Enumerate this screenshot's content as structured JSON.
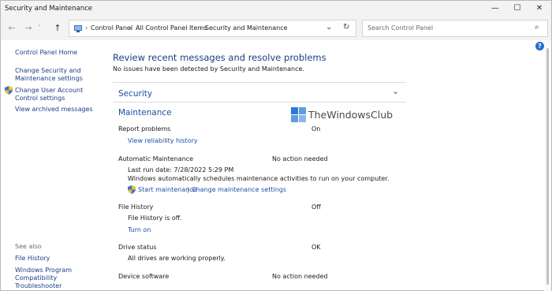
{
  "window": {
    "title": "Security and Maintenance",
    "minimize_glyph": "—",
    "maximize_glyph": "☐",
    "close_glyph": "✕"
  },
  "nav": {
    "back_glyph": "←",
    "forward_glyph": "→",
    "dropdown_glyph": "˅",
    "up_glyph": "↑",
    "breadcrumb": [
      "Control Panel",
      "All Control Panel Items",
      "Security and Maintenance"
    ],
    "separator": "›",
    "address_dropdown_glyph": "⌄",
    "refresh_glyph": "↻",
    "search_placeholder": "Search Control Panel",
    "search_glyph": "⌕"
  },
  "help_glyph": "?",
  "sidebar": {
    "home": "Control Panel Home",
    "links": [
      "Change Security and Maintenance settings",
      "Change User Account Control settings",
      "View archived messages"
    ],
    "see_also_label": "See also",
    "see_also": [
      "File History",
      "Windows Program Compatibility Troubleshooter"
    ]
  },
  "main": {
    "heading": "Review recent messages and resolve problems",
    "subheading": "No issues have been detected by Security and Maintenance.",
    "security_title": "Security",
    "maintenance_title": "Maintenance",
    "chevron_glyph": "⌄",
    "report_problems": {
      "label": "Report problems",
      "status": "On",
      "link": "View reliability history"
    },
    "automatic_maintenance": {
      "label": "Automatic Maintenance",
      "status": "No action needed",
      "last_run": "Last run date: 7/28/2022 5:29 PM",
      "description": "Windows automatically schedules maintenance activities to run on your computer.",
      "start_link": "Start maintenance",
      "separator": "|",
      "settings_link": "Change maintenance settings"
    },
    "file_history": {
      "label": "File History",
      "status": "Off",
      "description": "File History is off.",
      "link": "Turn on"
    },
    "drive_status": {
      "label": "Drive status",
      "status": "OK",
      "description": "All drives are working properly."
    },
    "device_software": {
      "label": "Device software",
      "status": "No action needed"
    }
  },
  "watermark": {
    "text": "TheWindowsClub"
  },
  "colors": {
    "link": "#1e4da8",
    "header": "#1e3f80",
    "shield_blue": "#3a74d6",
    "shield_yellow": "#f0c02c",
    "watermark_blue": "#2b7bd6"
  }
}
